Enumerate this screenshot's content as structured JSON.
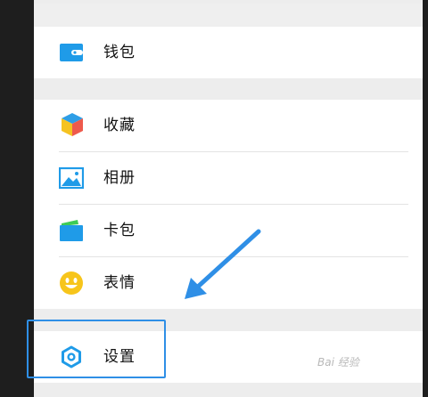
{
  "menu": {
    "wallet": {
      "label": "钱包",
      "icon": "wallet-icon"
    },
    "favorites": {
      "label": "收藏",
      "icon": "favorites-cube-icon"
    },
    "album": {
      "label": "相册",
      "icon": "album-picture-icon"
    },
    "cards": {
      "label": "卡包",
      "icon": "card-wallet-icon"
    },
    "stickers": {
      "label": "表情",
      "icon": "smiley-icon"
    },
    "settings": {
      "label": "设置",
      "icon": "gear-icon"
    }
  },
  "colors": {
    "accent": "#2f8fe6",
    "section_gap": "#ededed",
    "dark_edge": "#1e1e1e"
  },
  "watermark": "Bai 经验"
}
